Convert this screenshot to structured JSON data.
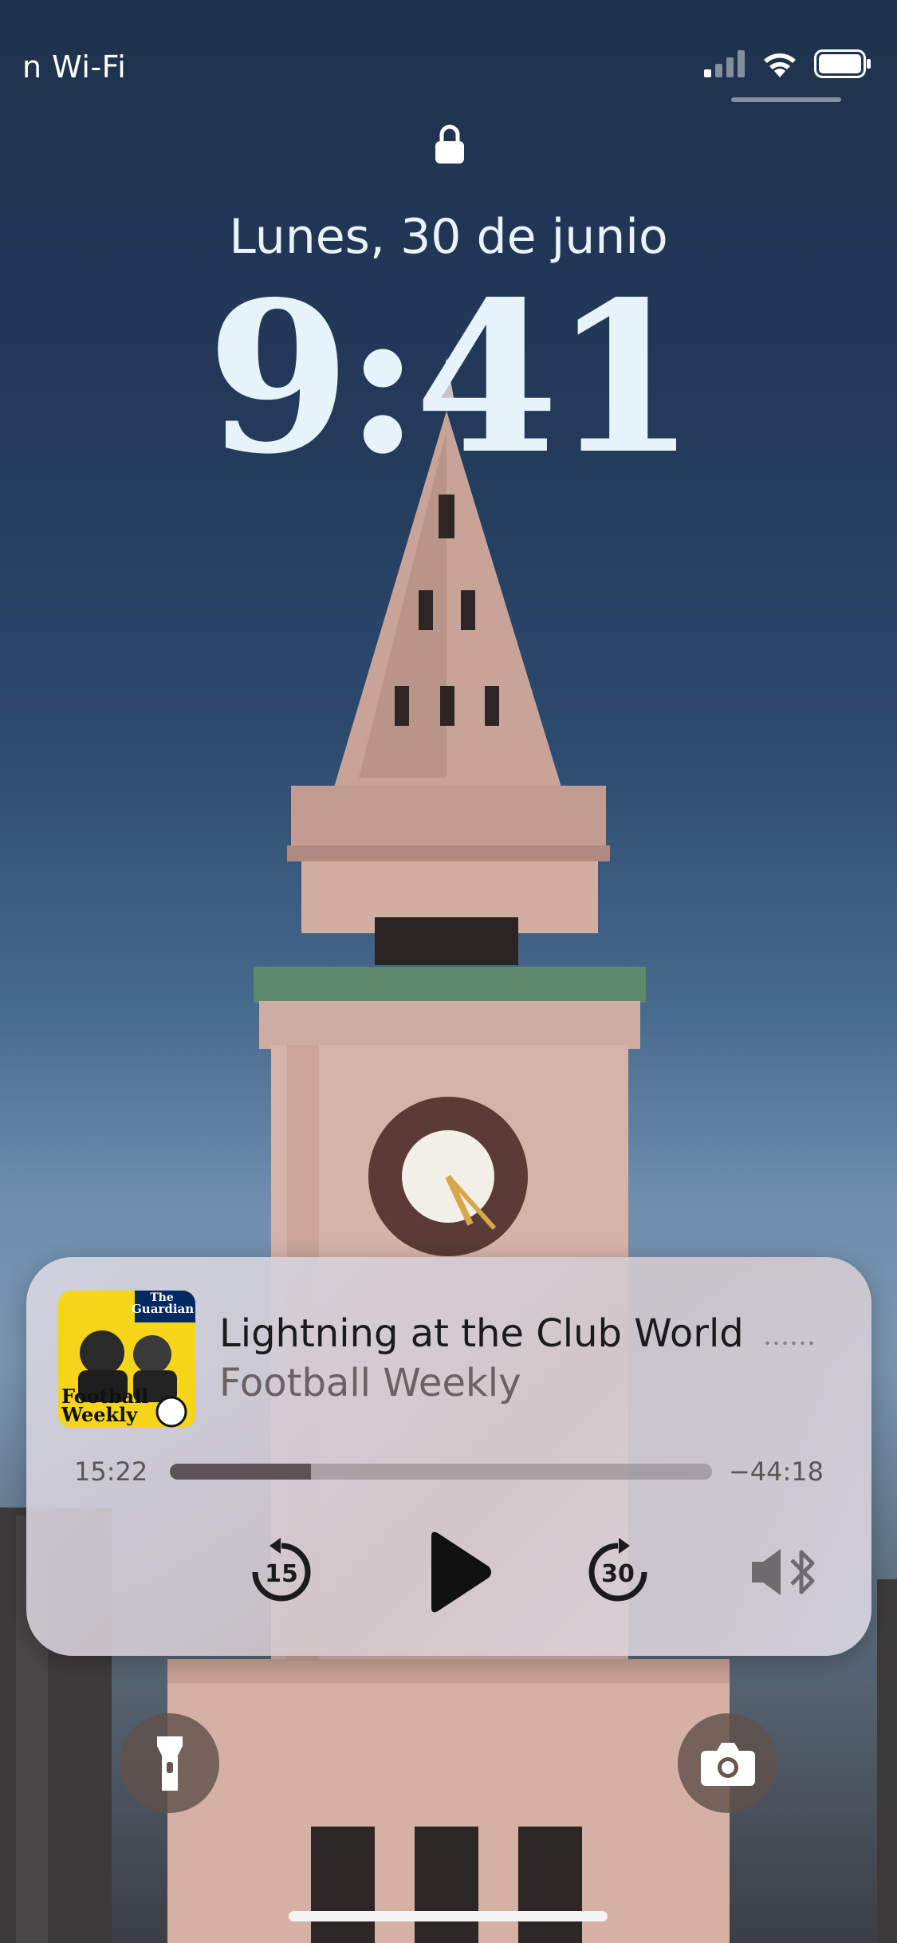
{
  "status_bar": {
    "carrier": "n Wi-Fi",
    "icons": [
      "signal-icon",
      "wifi-icon",
      "battery-icon"
    ]
  },
  "lock_screen": {
    "date": "Lunes, 30 de junio",
    "time": "9:41"
  },
  "now_playing": {
    "title": "Lightning at the Club World",
    "subtitle": "Football Weekly",
    "artwork": {
      "brand_line1": "The",
      "brand_line2": "Guardian",
      "show_line1": "Football",
      "show_line2": "Weekly"
    },
    "elapsed": "15:22",
    "remaining": "−44:18",
    "progress_fraction": 0.26,
    "controls": {
      "skip_back_seconds": "15",
      "skip_forward_seconds": "30"
    }
  },
  "quick_actions": [
    "flashlight-icon",
    "camera-icon"
  ],
  "colors": {
    "text_primary": "#1b1b1d",
    "text_secondary": "#6a6164",
    "artwork_yellow": "#f4d51a",
    "guardian_navy": "#052962"
  }
}
